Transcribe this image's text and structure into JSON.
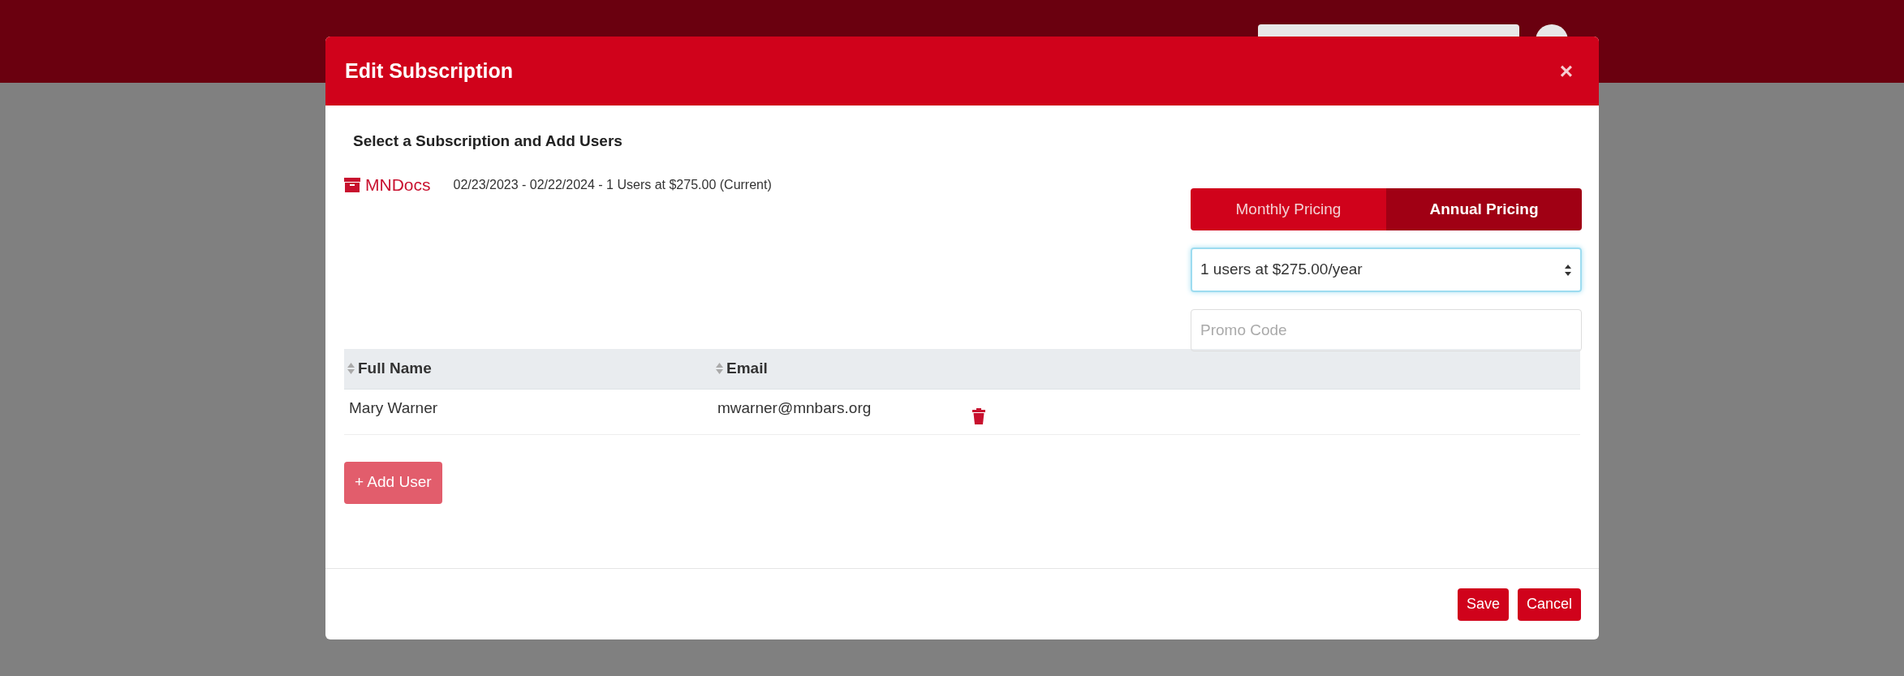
{
  "modal": {
    "title": "Edit Subscription",
    "close": "×",
    "heading": "Select a Subscription and Add Users",
    "subscriptions": [
      {
        "name": "MNDocs",
        "details": "02/23/2023 - 02/22/2024 - 1 Users at $275.00 (Current)"
      }
    ],
    "pricing_tabs": [
      {
        "label": "Monthly Pricing",
        "selected": false
      },
      {
        "label": "Annual Pricing",
        "selected": true
      }
    ],
    "plan_select": {
      "value": "1 users at $275.00/year"
    },
    "promo": {
      "placeholder": "Promo Code"
    },
    "table": {
      "columns": [
        "Full Name",
        "Email"
      ],
      "rows": [
        {
          "cells": [
            "Mary Warner",
            "mwarner@mnbars.org"
          ]
        }
      ]
    },
    "add_button": "+ Add User",
    "footer_buttons": [
      "Save",
      "Cancel"
    ]
  }
}
